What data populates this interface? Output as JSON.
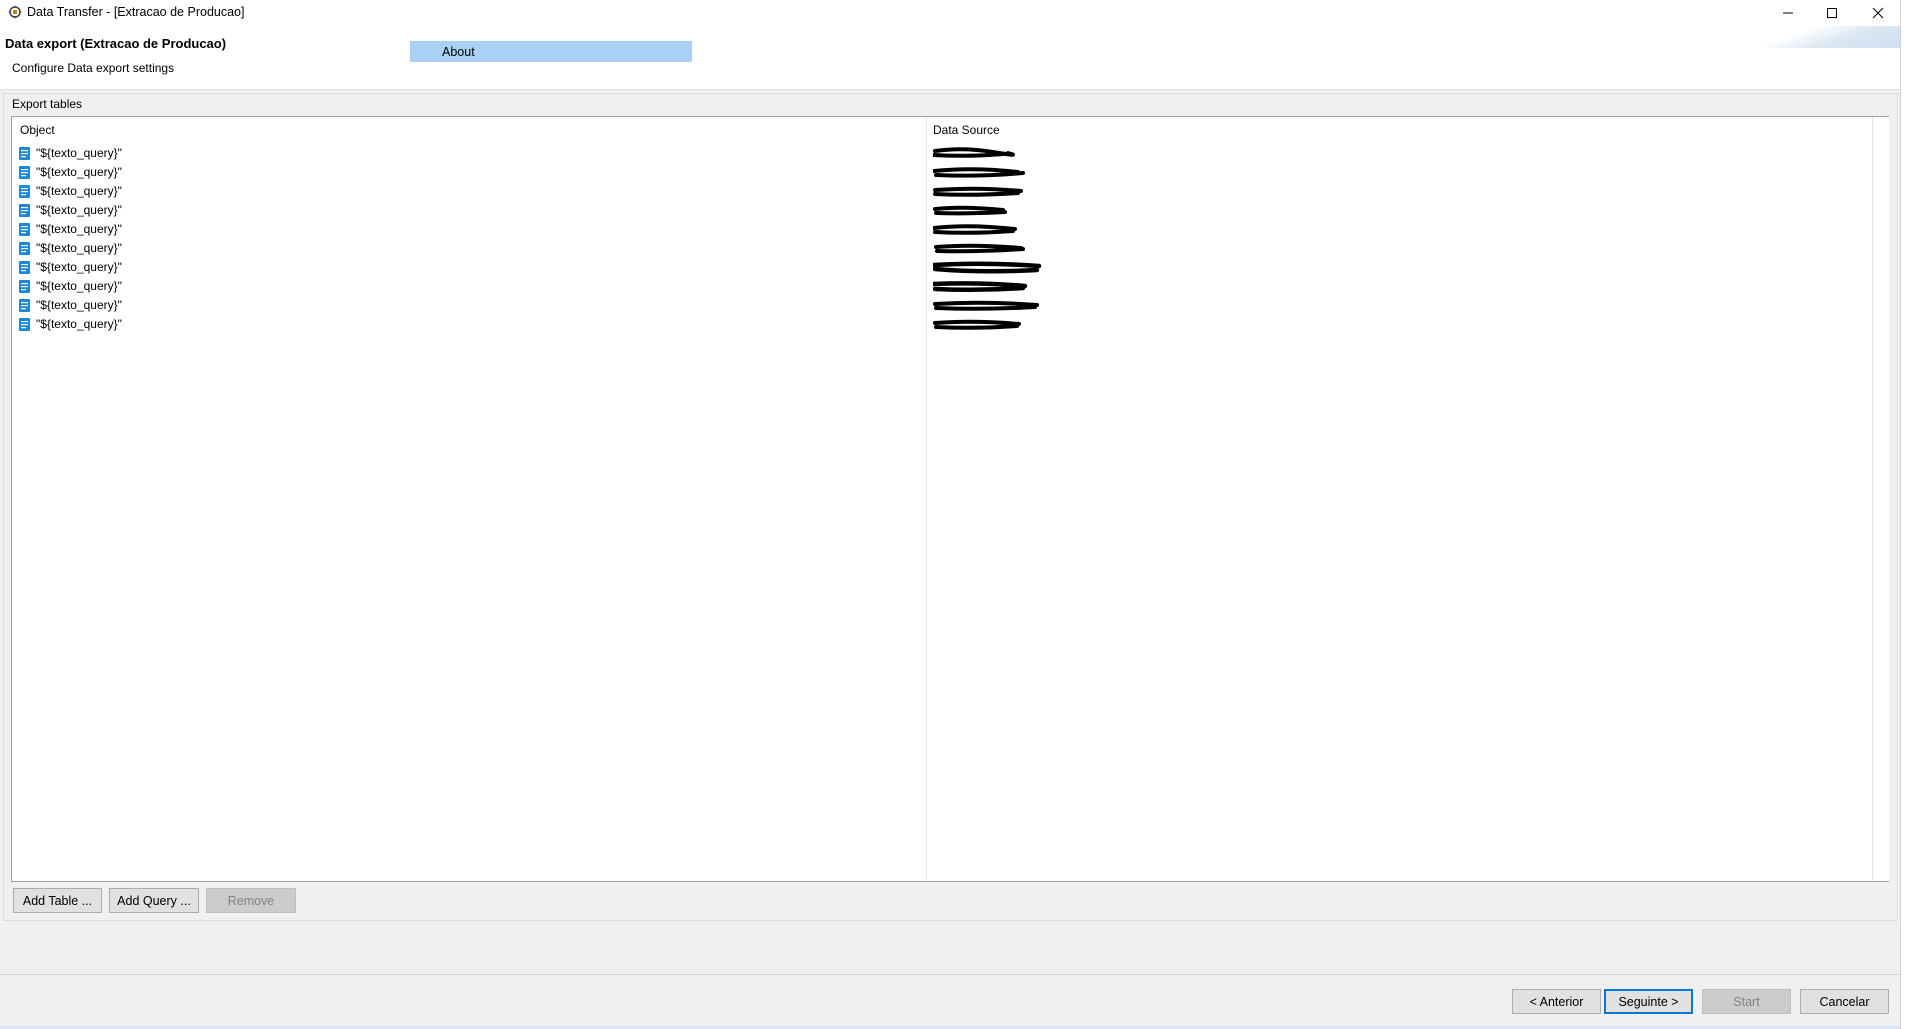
{
  "window": {
    "title": "Data Transfer - [Extracao de Producao]"
  },
  "header": {
    "title": "Data export (Extracao de Producao)",
    "subtitle": "Configure Data export settings",
    "about_tab": "About"
  },
  "export_tables": {
    "group_label": "Export tables",
    "columns": {
      "object": "Object",
      "data_source": "Data Source"
    },
    "rows": [
      {
        "object": "\"${texto_query}\"",
        "data_source_redacted": true
      },
      {
        "object": "\"${texto_query}\"",
        "data_source_redacted": true
      },
      {
        "object": "\"${texto_query}\"",
        "data_source_redacted": true
      },
      {
        "object": "\"${texto_query}\"",
        "data_source_redacted": true
      },
      {
        "object": "\"${texto_query}\"",
        "data_source_redacted": true
      },
      {
        "object": "\"${texto_query}\"",
        "data_source_redacted": true
      },
      {
        "object": "\"${texto_query}\"",
        "data_source_redacted": true
      },
      {
        "object": "\"${texto_query}\"",
        "data_source_redacted": true
      },
      {
        "object": "\"${texto_query}\"",
        "data_source_redacted": true
      },
      {
        "object": "\"${texto_query}\"",
        "data_source_redacted": true
      }
    ],
    "buttons": {
      "add_table": "Add Table ...",
      "add_query": "Add Query ...",
      "remove": "Remove"
    }
  },
  "footer": {
    "back": "< Anterior",
    "next": "Seguinte >",
    "start": "Start",
    "cancel": "Cancelar"
  },
  "colors": {
    "about_tab": "#a8d1f5",
    "row_icon": "#1e88d6",
    "default_button_border": "#0078d7"
  },
  "icons": {
    "row_icon": "query-document-icon",
    "app_icon": "data-transfer-icon"
  }
}
